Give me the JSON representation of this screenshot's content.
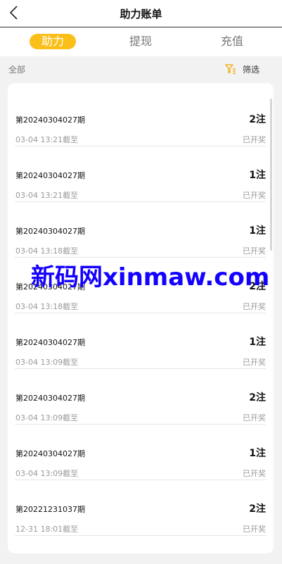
{
  "header": {
    "title": "助力账单"
  },
  "tabs": [
    {
      "label": "助力",
      "active": true
    },
    {
      "label": "提现",
      "active": false
    },
    {
      "label": "充值",
      "active": false
    }
  ],
  "filter": {
    "scope_label": "全部",
    "button_label": "筛选",
    "icon": "filter-icon"
  },
  "list": [
    {
      "period": "第20240304027期",
      "count": "2注",
      "deadline": "03-04 13:21截至",
      "status": "已开奖"
    },
    {
      "period": "第20240304027期",
      "count": "1注",
      "deadline": "03-04 13:21截至",
      "status": "已开奖"
    },
    {
      "period": "第20240304027期",
      "count": "1注",
      "deadline": "03-04 13:18截至",
      "status": "已开奖"
    },
    {
      "period": "第20240304027期",
      "count": "2注",
      "deadline": "03-04 13:18截至",
      "status": "已开奖"
    },
    {
      "period": "第20240304027期",
      "count": "1注",
      "deadline": "03-04 13:09截至",
      "status": "已开奖"
    },
    {
      "period": "第20240304027期",
      "count": "2注",
      "deadline": "03-04 13:09截至",
      "status": "已开奖"
    },
    {
      "period": "第20240304027期",
      "count": "1注",
      "deadline": "03-04 13:09截至",
      "status": "已开奖"
    },
    {
      "period": "第20221231037期",
      "count": "2注",
      "deadline": "12-31 18:01截至",
      "status": "已开奖"
    }
  ],
  "watermark": "新码网xinmaw.com",
  "colors": {
    "accent": "#fbbf1a",
    "watermark": "#1400ff",
    "muted_text": "#999999"
  }
}
